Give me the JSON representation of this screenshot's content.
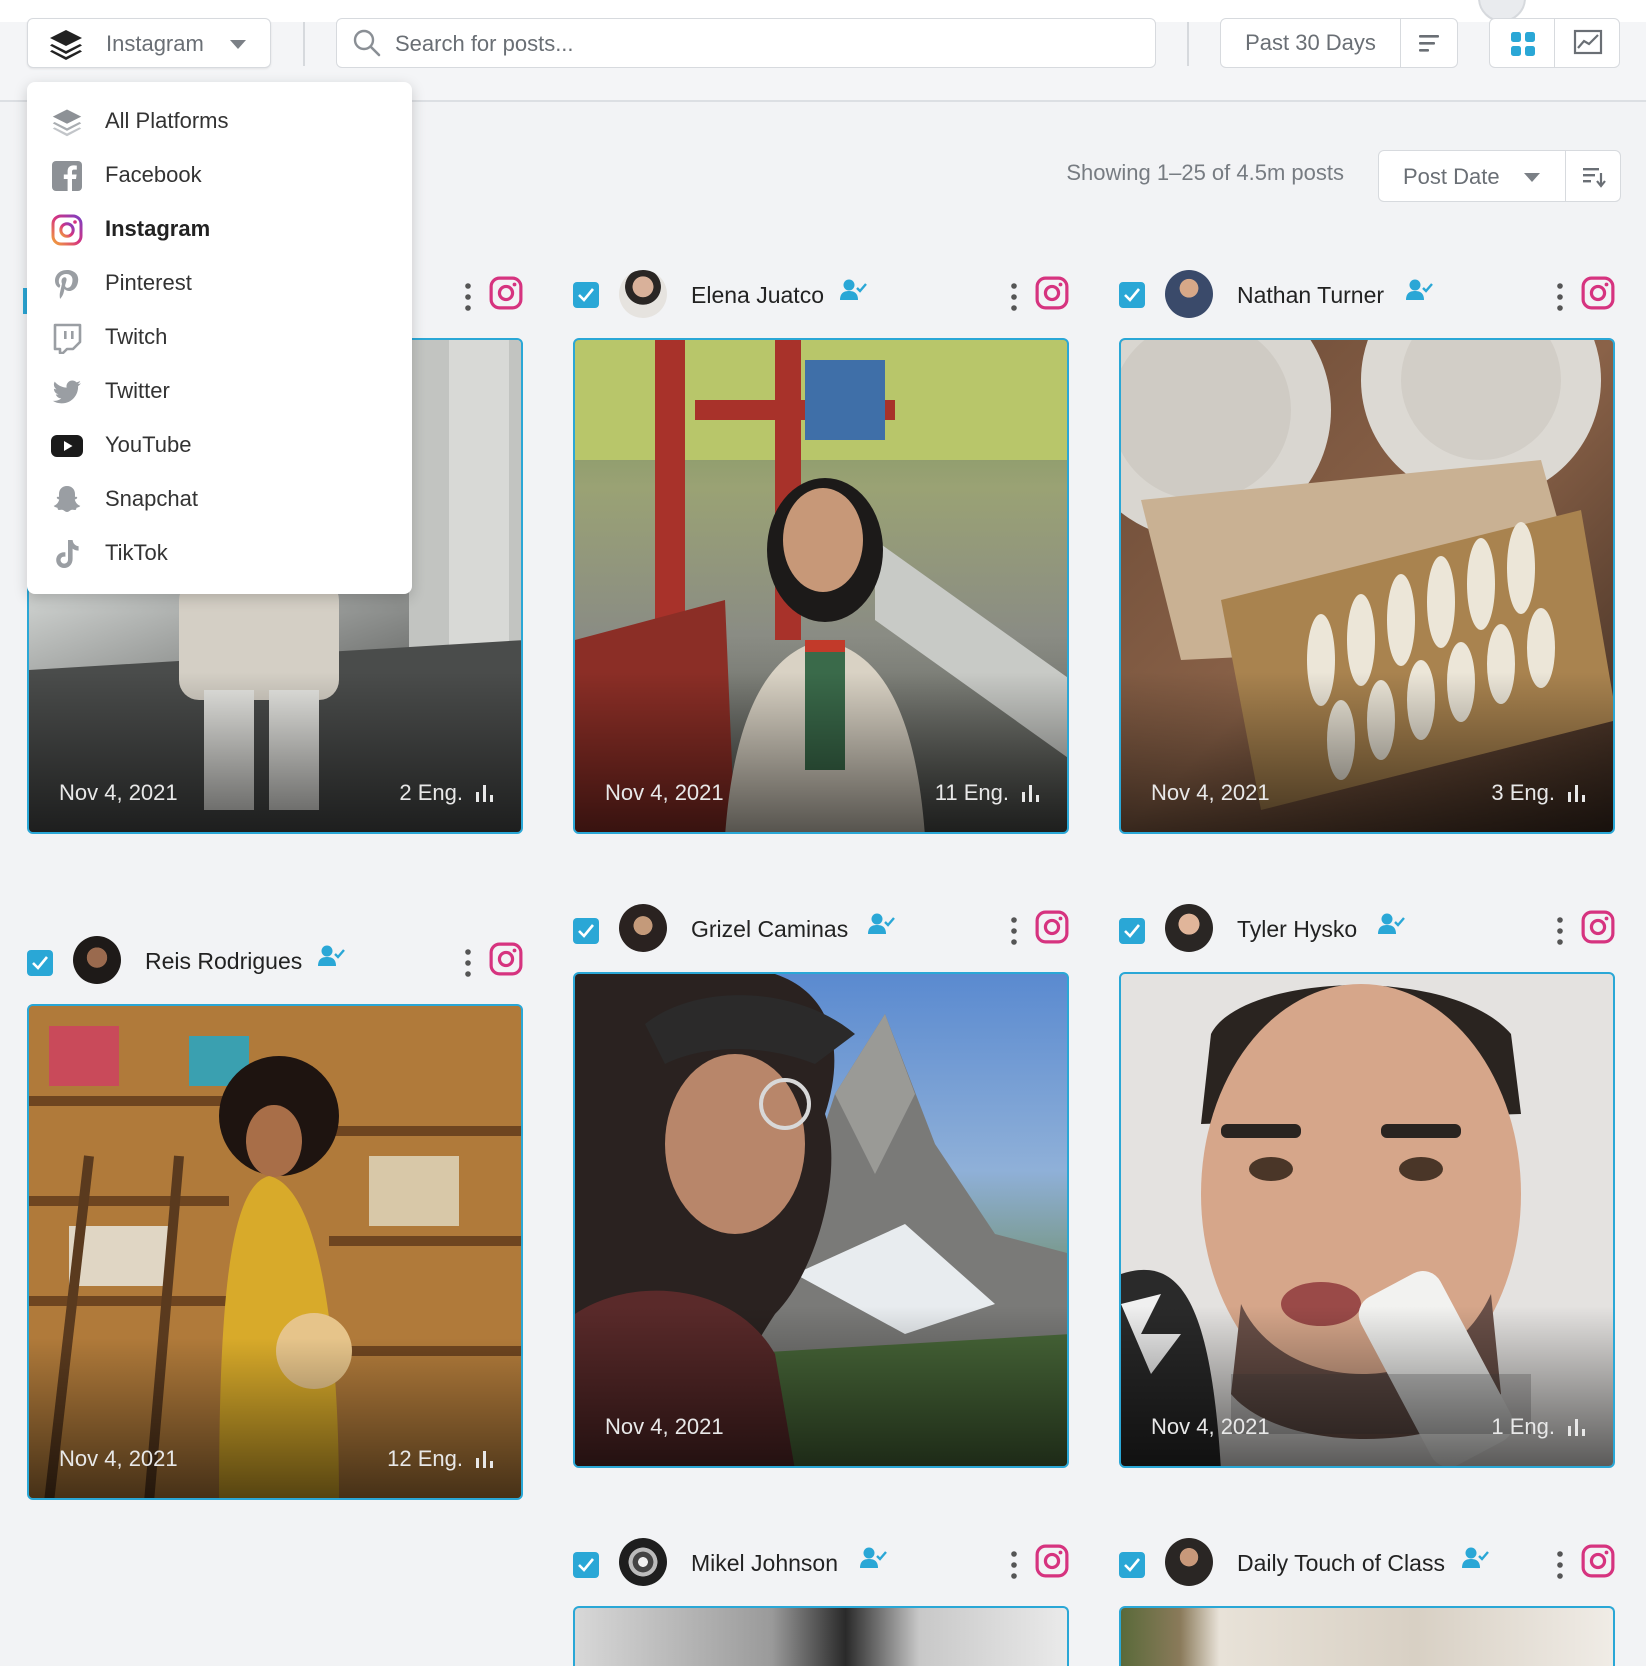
{
  "toolbar": {
    "platform_selected": "Instagram",
    "search_placeholder": "Search for posts...",
    "date_range": "Past 30 Days"
  },
  "results": {
    "showing": "Showing 1–25 of 4.5m posts",
    "sort_by": "Post Date"
  },
  "platform_menu": [
    {
      "label": "All Platforms",
      "icon": "layers-icon"
    },
    {
      "label": "Facebook",
      "icon": "facebook-icon"
    },
    {
      "label": "Instagram",
      "icon": "instagram-icon",
      "active": true
    },
    {
      "label": "Pinterest",
      "icon": "pinterest-icon"
    },
    {
      "label": "Twitch",
      "icon": "twitch-icon"
    },
    {
      "label": "Twitter",
      "icon": "twitter-icon"
    },
    {
      "label": "YouTube",
      "icon": "youtube-icon"
    },
    {
      "label": "Snapchat",
      "icon": "snapchat-icon"
    },
    {
      "label": "TikTok",
      "icon": "tiktok-icon"
    }
  ],
  "posts": [
    {
      "name": "",
      "date": "Nov 4, 2021",
      "eng": "2 Eng."
    },
    {
      "name": "Elena Juatco",
      "date": "Nov 4, 2021",
      "eng": "11 Eng."
    },
    {
      "name": "Nathan Turner",
      "date": "Nov 4, 2021",
      "eng": "3 Eng."
    },
    {
      "name": "Reis Rodrigues",
      "date": "Nov 4, 2021",
      "eng": "12 Eng."
    },
    {
      "name": "Grizel Caminas",
      "date": "Nov 4, 2021",
      "eng": ""
    },
    {
      "name": "Tyler Hysko",
      "date": "Nov 4, 2021",
      "eng": "1 Eng."
    },
    {
      "name": "Mikel Johnson",
      "date": "",
      "eng": ""
    },
    {
      "name": "Daily Touch of Class",
      "date": "",
      "eng": ""
    }
  ],
  "colors": {
    "accent": "#2aa7d6",
    "instagram": "#d6337f"
  }
}
